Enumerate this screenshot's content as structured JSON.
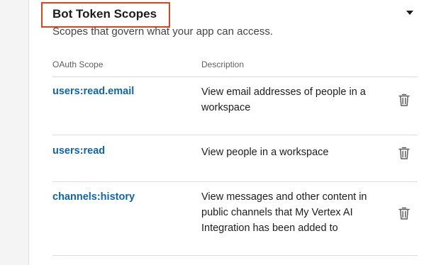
{
  "section": {
    "title": "Bot Token Scopes",
    "subtitle": "Scopes that govern what your app can access.",
    "columns": {
      "scope": "OAuth Scope",
      "description": "Description"
    },
    "rows": [
      {
        "scope": "users:read.email",
        "description": "View email addresses of people in a workspace",
        "action_icon": "trash-icon"
      },
      {
        "scope": "users:read",
        "description": "View people in a workspace",
        "action_icon": "trash-icon"
      },
      {
        "scope": "channels:history",
        "description": "View messages and other content in public channels that My Vertex AI Integration has been added to",
        "action_icon": "trash-icon"
      }
    ]
  },
  "colors": {
    "highlight": "#e0421b",
    "link": "#1264a3",
    "text": "#1d1c1d",
    "muted": "#616061"
  }
}
